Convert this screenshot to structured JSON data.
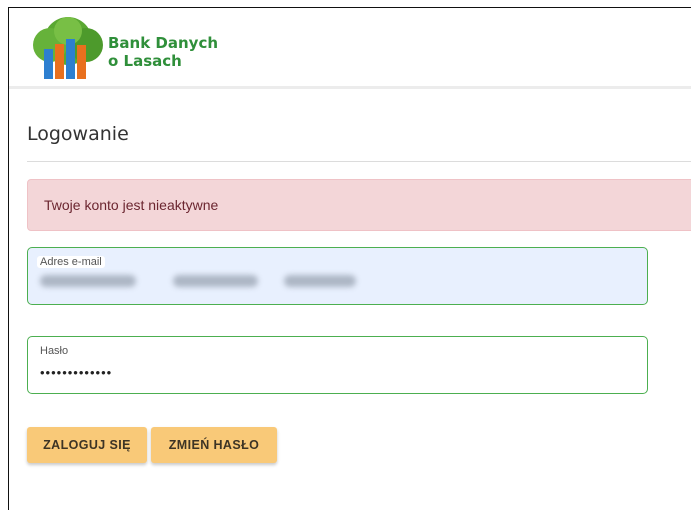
{
  "header": {
    "brand_line1": "Bank Danych",
    "brand_line2": "o Lasach"
  },
  "page": {
    "title": "Logowanie"
  },
  "alert": {
    "message": "Twoje konto jest nieaktywne"
  },
  "form": {
    "email": {
      "label": "Adres e-mail"
    },
    "password": {
      "label": "Hasło",
      "value": "•••••••••••••"
    }
  },
  "buttons": {
    "login": "ZALOGUJ SIĘ",
    "change_password": "ZMIEŃ HASŁO"
  },
  "colors": {
    "brand_green": "#2f8f3a",
    "alert_bg": "#f3d6d8",
    "field_border": "#4caf50",
    "button_bg": "#f9c978"
  }
}
